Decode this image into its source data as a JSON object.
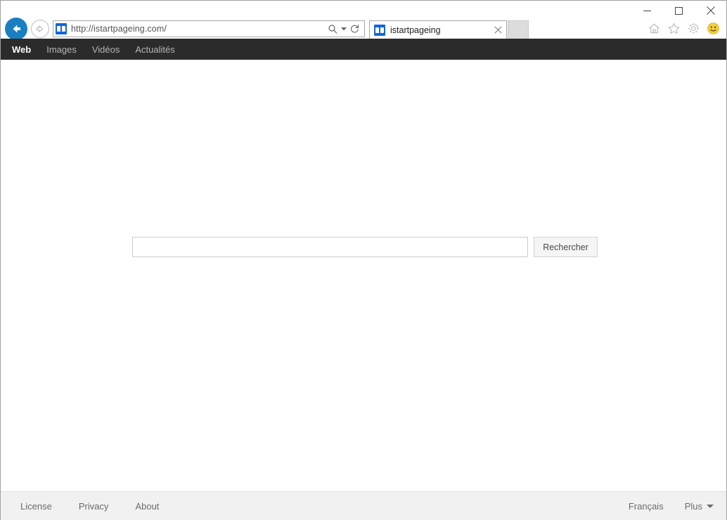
{
  "browser": {
    "name": "Internet Explorer",
    "address_bar": {
      "url": "http://istartpageing.com/",
      "favicon_name": "book-favicon",
      "search_icon": "search-icon",
      "dropdown_icon": "chevron-down-icon",
      "refresh_icon": "refresh-icon"
    },
    "back_button": {
      "icon": "arrow-left-icon",
      "color": "#1a7fc1"
    },
    "forward_button": {
      "icon": "arrow-right-icon"
    },
    "tabs": [
      {
        "title": "istartpageing",
        "favicon_name": "book-favicon",
        "close_icon": "close-icon",
        "active": true
      }
    ],
    "new_tab_button": {
      "label": "",
      "name": "new-tab-button"
    },
    "toolbar_icons": [
      {
        "name": "home-icon",
        "label": "Home"
      },
      {
        "name": "favorites-star-icon",
        "label": "Favorites"
      },
      {
        "name": "settings-gear-icon",
        "label": "Tools"
      },
      {
        "name": "feedback-smiley-icon",
        "label": "Send feedback"
      }
    ],
    "window_controls": [
      {
        "name": "minimize-button",
        "glyph": "minimize"
      },
      {
        "name": "maximize-button",
        "glyph": "maximize"
      },
      {
        "name": "close-button",
        "glyph": "close"
      }
    ],
    "progress_color": "#e8492f"
  },
  "page": {
    "nav": {
      "items": [
        {
          "label": "Web",
          "active": true
        },
        {
          "label": "Images",
          "active": false
        },
        {
          "label": "Vidéos",
          "active": false
        },
        {
          "label": "Actualités",
          "active": false
        }
      ],
      "background": "#2b2b2b"
    },
    "search": {
      "value": "",
      "placeholder": "",
      "button_label": "Rechercher"
    },
    "footer": {
      "links": [
        {
          "label": "License"
        },
        {
          "label": "Privacy"
        },
        {
          "label": "About"
        }
      ],
      "language": "Français",
      "more_label": "Plus",
      "more_caret_icon": "caret-down-icon",
      "background": "#f1f1f1"
    }
  }
}
